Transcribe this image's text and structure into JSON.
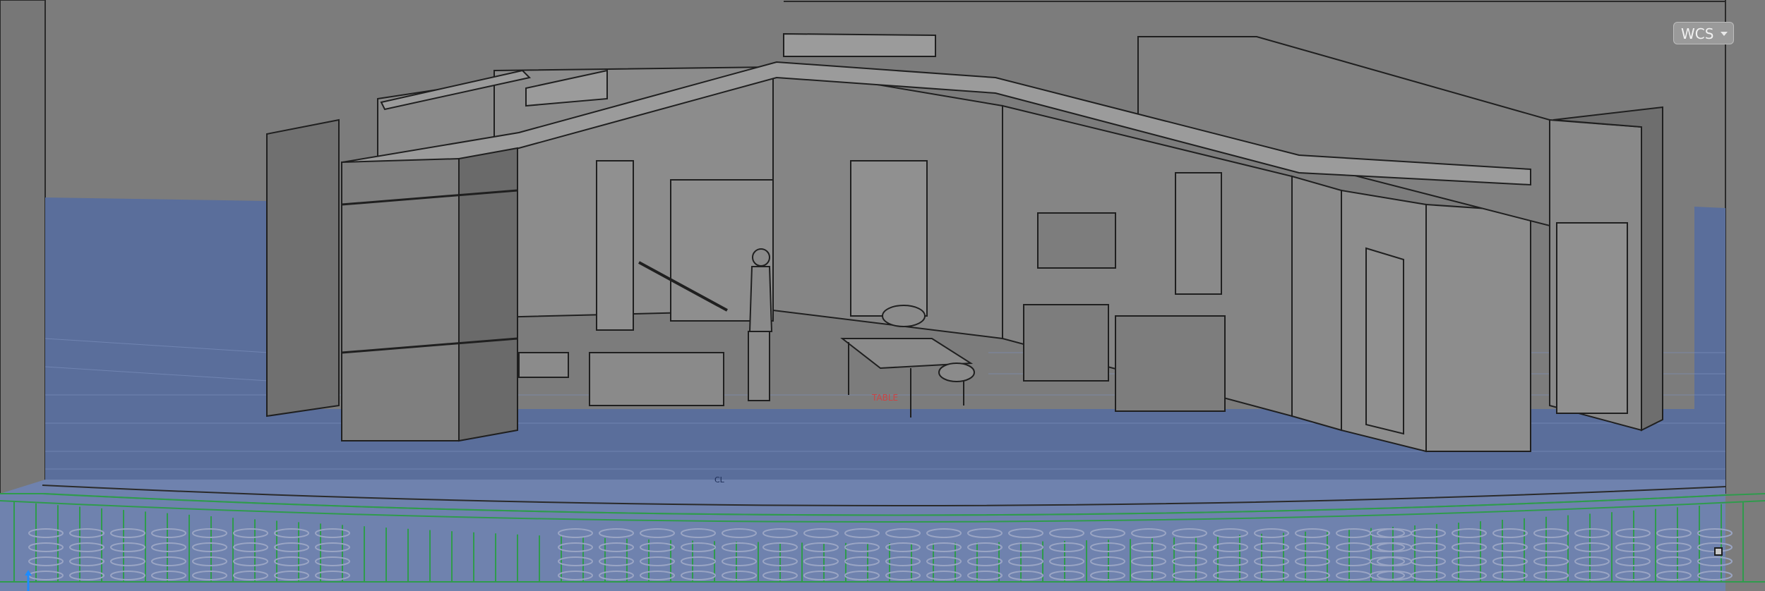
{
  "viewport": {
    "view_cube_label": "WCS",
    "background_color": "#7b7b7b",
    "stage_floor_color": "#5b6f9a",
    "seating_edge_color": "#2f9b4c"
  },
  "floor_labels": {
    "table_tag": "TABLE",
    "center_mark": "CL"
  },
  "icons": {
    "view_cube": "view-cube-icon",
    "ucs": "ucs-icon",
    "grip": "grip-icon"
  }
}
